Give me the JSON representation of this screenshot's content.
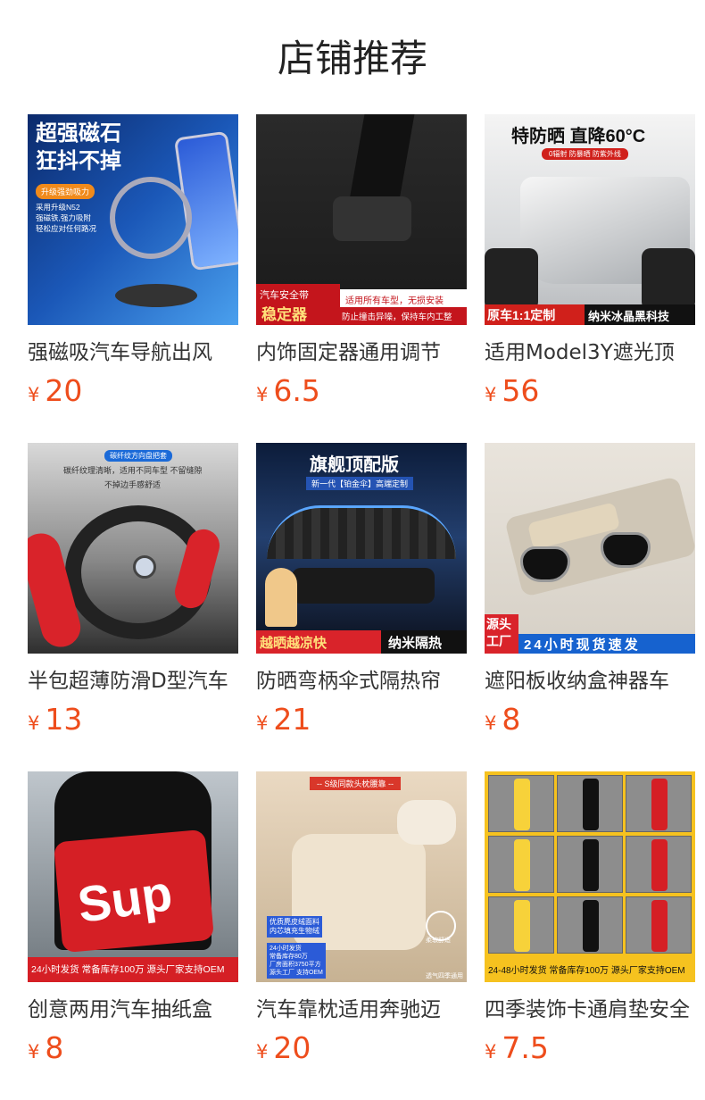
{
  "page_title": "店铺推荐",
  "currency_symbol": "¥",
  "products": [
    {
      "name": "强磁吸汽车导航出风",
      "price": "20",
      "thumb_text": {
        "headline": "超强磁石\n狂抖不掉",
        "tag": "升级强劲吸力",
        "small": "采用升级N52\n强磁铁,强力吸附\n轻松应对任何路况"
      }
    },
    {
      "name": "内饰固定器通用调节",
      "price": "6.5",
      "thumb_text": {
        "red_top": "汽车安全带",
        "red_main": "稳定器",
        "white": "适用所有车型，无损安装",
        "bottom": "防止撞击异噪，保持车内工整"
      }
    },
    {
      "name": "适用Model3Y遮光顶",
      "price": "56",
      "thumb_text": {
        "headline": "特防晒 直降60°C",
        "sub": "0辐射 防暴晒 防紫外线",
        "red_bar": "原车1:1定制",
        "black_bar": "纳米冰晶黑科技"
      }
    },
    {
      "name": "半包超薄防滑D型汽车",
      "price": "13",
      "thumb_text": {
        "pill": "碳纤纹方向盘把套",
        "line1": "碳纤纹理清晰，适用不同车型 不留缝隙",
        "line2": "不掉边手感舒适"
      }
    },
    {
      "name": "防晒弯柄伞式隔热帘",
      "price": "21",
      "thumb_text": {
        "headline": "旗舰顶配版",
        "sub": "新一代【铂金伞】高端定制",
        "red_bar": "越晒越凉快",
        "black_bar": "纳米隔热"
      }
    },
    {
      "name": "遮阳板收纳盒神器车",
      "price": "8",
      "thumb_text": {
        "red_box": "源头\n工厂",
        "blue_bar": "24小时现货速发"
      }
    },
    {
      "name": "创意两用汽车抽纸盒",
      "price": "8",
      "thumb_text": {
        "logo": "Sup",
        "red_bar": "24小时发货 常备库存100万 源头厂家支持OEM"
      }
    },
    {
      "name": "汽车靠枕适用奔驰迈",
      "price": "20",
      "thumb_text": {
        "banner": "-- S级同款头枕腰靠 --",
        "box1": "优质麂皮绒面料\n内芯填充生物绒",
        "box2": "24小时发货\n常备库存80万\n厂房面积3750平方\n源头工厂 支持OEM",
        "badge1": "柔软舒适",
        "badge2": "透气四季通用"
      }
    },
    {
      "name": "四季装饰卡通肩垫安全",
      "price": "7.5",
      "thumb_text": {
        "bottom": "24-48小时发货 常备库存100万 源头厂家支持OEM"
      }
    }
  ],
  "colors": {
    "price": "#ee4d1c",
    "title": "#222222",
    "name": "#333333"
  }
}
